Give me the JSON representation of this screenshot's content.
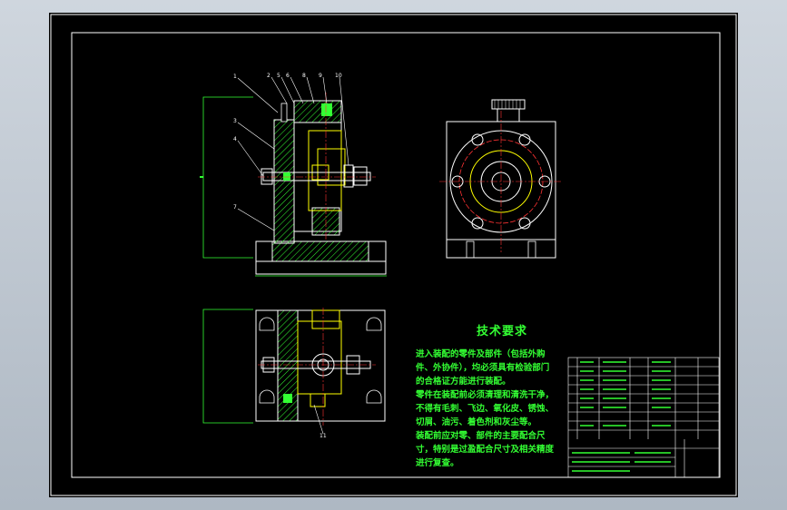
{
  "drawing": {
    "technical_requirements": {
      "title": "技术要求",
      "lines": [
        "进入装配的零件及部件（包括外购",
        "件、外协件），均必须具有检验部门",
        "的合格证方能进行装配。",
        "零件在装配前必须清理和清洗干净，",
        "不得有毛刺、飞边、氧化皮、锈蚀、",
        "切屑、油污、着色剂和灰尘等。",
        "装配前应对零、部件的主要配合尺",
        "寸，特别是过盈配合尺寸及相关精度",
        "进行复查。"
      ]
    },
    "callouts": [
      "1",
      "2",
      "3",
      "4",
      "5",
      "6",
      "7",
      "8",
      "9",
      "10",
      "11"
    ],
    "colors": {
      "sheet": "#000000",
      "frame": "#ffffff",
      "text": "#33ff33",
      "outline": "#ffffff",
      "hatch": "#33ff33",
      "part": "#ffff00",
      "center_line": "#ff3333"
    }
  }
}
